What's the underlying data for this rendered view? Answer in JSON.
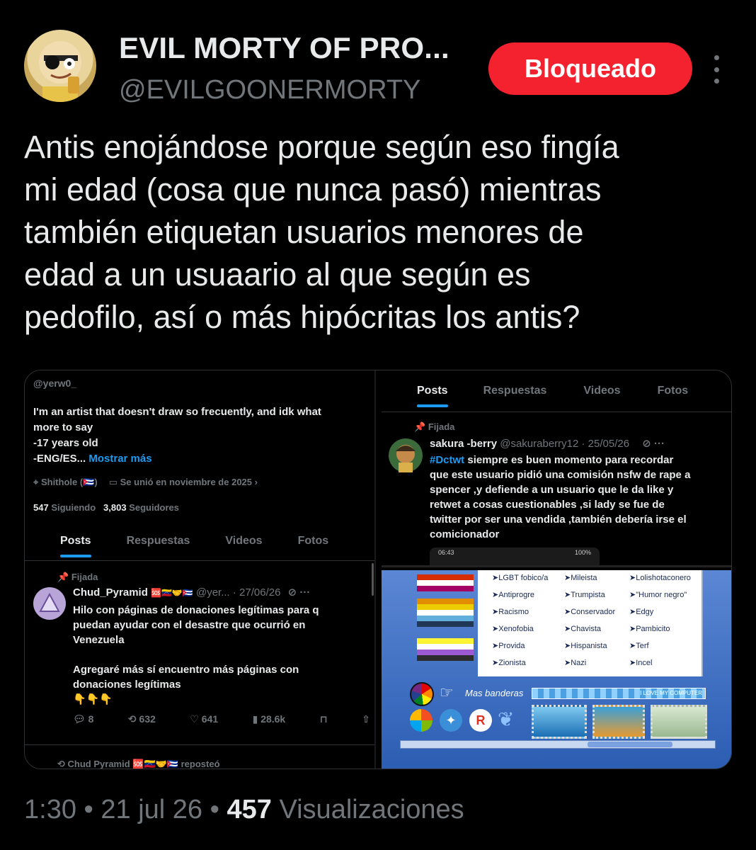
{
  "header": {
    "display_name": "EVIL MORTY OF PRO...",
    "handle": "@EVILGOONERMORTY",
    "blocked_label": "Bloqueado"
  },
  "tweet": {
    "lines": [
      "Antis enojándose porque según eso fingía",
      "mi edad (cosa que nunca pasó) mientras",
      "también etiquetan usuarios menores de",
      "edad a un usuaario al que según es",
      "pedofilo, así o más hipócritas los antis?"
    ]
  },
  "media_left": {
    "handle": "@yerw0_",
    "bio_lines": [
      "I'm an artist that doesn't draw so frecuently, and idk what",
      "more to say",
      "-17 years old"
    ],
    "bio_last": "-ENG/ES...",
    "show_more": "Mostrar más",
    "location": "Shithole (🇨🇺)",
    "joined": "Se unió en noviembre de 2025",
    "following_count": "547",
    "following_label": "Siguiendo",
    "followers_count": "3,803",
    "followers_label": "Seguidores",
    "tabs": [
      "Posts",
      "Respuestas",
      "Videos",
      "Fotos"
    ],
    "pinned_label": "Fijada",
    "post": {
      "author": "Chud_Pyramid",
      "author_extra": "🆘🇻🇪🤝🇨🇺",
      "handle_date": "@yer... · 27/06/26",
      "lines": [
        "Hilo con páginas de donaciones legítimas para q",
        "puedan ayudar con el desastre que ocurrió en",
        "Venezuela",
        "",
        "Agregaré más sí encuentro más páginas con",
        "donaciones legítimas",
        "👇👇👇"
      ],
      "replies": "8",
      "reposts": "632",
      "likes": "641",
      "views": "28.6k"
    },
    "repost_line": "Chud Pyramid 🆘🇻🇪🤝🇨🇺 reposteó"
  },
  "media_right_top": {
    "tabs": [
      "Posts",
      "Respuestas",
      "Videos",
      "Fotos"
    ],
    "pinned_label": "Fijada",
    "author": "sakura -berry",
    "handle_date": "@sakuraberry12 · 25/05/26",
    "hashtag": "#Dctwt",
    "lines_first": "siempre es buen momento para recordar",
    "lines": [
      "que este usuario pidió una comisión nsfw de rape a",
      "spencer ,y defiende a un usuario que le da like y",
      "retwet a cosas cuestionables ,si lady se fue de",
      "twitter por ser una vendida ,también debería irse el",
      "comicionador"
    ],
    "status_time": "06:43",
    "status_battery": "100%"
  },
  "media_right_bottom": {
    "col1": [
      "➤LGBT fobico/a",
      "➤Antiprogre",
      "➤Racismo",
      "➤Xenofobia",
      "➤Provida",
      "➤Zionista"
    ],
    "col2": [
      "➤Mileista",
      "➤Trumpista",
      "➤Conservador",
      "➤Chavista",
      "➤Hispanista",
      "➤Nazi"
    ],
    "col3": [
      "➤Lolishotaconero",
      "➤\"Humor negro\"",
      "➤Edgy",
      "➤Pambicito",
      "➤Terf",
      "➤Incel"
    ],
    "more_flags": "Mas banderas",
    "banner": "I LOVE MY COMPUTER"
  },
  "footer": {
    "time": "1:30",
    "date": "21 jul 26",
    "views_count": "457",
    "views_label": "Visualizaciones"
  }
}
